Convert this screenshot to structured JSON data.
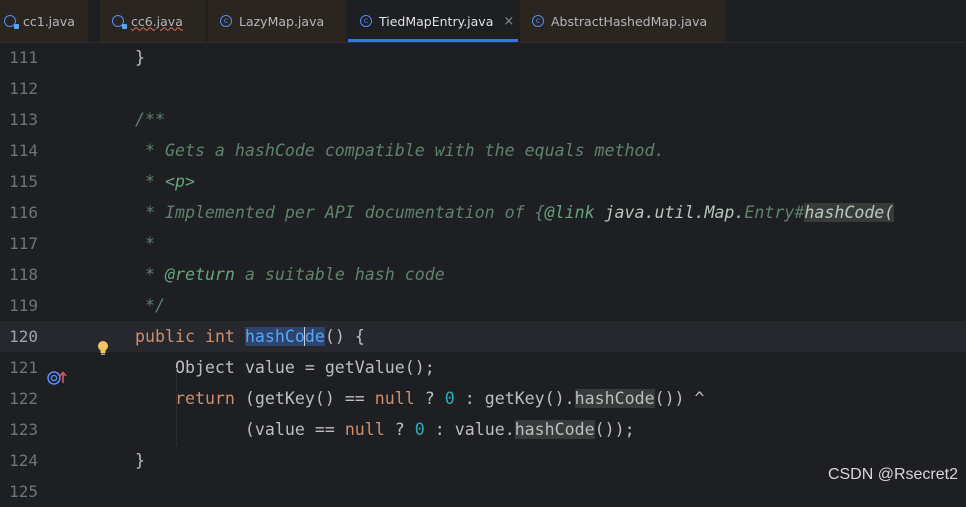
{
  "tabs": [
    {
      "label": "cc1.java",
      "active": false,
      "run_config": true
    },
    {
      "label": "cc6.java",
      "active": false,
      "run_config": true,
      "has_error": true
    },
    {
      "label": "LazyMap.java",
      "active": false
    },
    {
      "label": "TiedMapEntry.java",
      "active": true,
      "closable": true,
      "close_glyph": "×"
    },
    {
      "label": "AbstractHashedMap.java",
      "active": false
    }
  ],
  "editor": {
    "current_line": "120",
    "line_numbers": [
      "111",
      "112",
      "113",
      "114",
      "115",
      "116",
      "117",
      "118",
      "119",
      "120",
      "121",
      "122",
      "123",
      "124",
      "125"
    ],
    "tokens": {
      "brace_close": "}",
      "doc_open": "/**",
      "doc_l114": " * Gets a hashCode compatible with the equals method.",
      "doc_l115_star": " * ",
      "doc_l115_tag": "<p>",
      "doc_l116_a": " * Implemented per API documentation of {",
      "doc_l116_tag": "@link",
      "doc_l116_b": " java.util.Map.",
      "doc_l116_c": "Entry#",
      "doc_l116_d": "hashCode(",
      "doc_star": " *",
      "doc_l118_star": " * ",
      "doc_l118_tag": "@return",
      "doc_l118_text": " a suitable hash code",
      "doc_close": " */",
      "kw_public": "public",
      "kw_int": "int",
      "m_hash_a": "hashCo",
      "m_hash_b": "de",
      "paren_open_brace": "() {",
      "l121": "    Object value = getValue();",
      "kw_return": "return",
      "l122_a": " (getKey() == ",
      "kw_null": "null",
      "l122_b": " ? ",
      "zero": "0",
      "l122_c": " : getKey().",
      "m_hashCode": "hashCode",
      "l122_d": "()) ^",
      "l123_a": "(value == ",
      "l123_b": " ? ",
      "l123_c": " : value.",
      "l123_d": "());"
    }
  },
  "watermark": "CSDN @Rsecret2"
}
